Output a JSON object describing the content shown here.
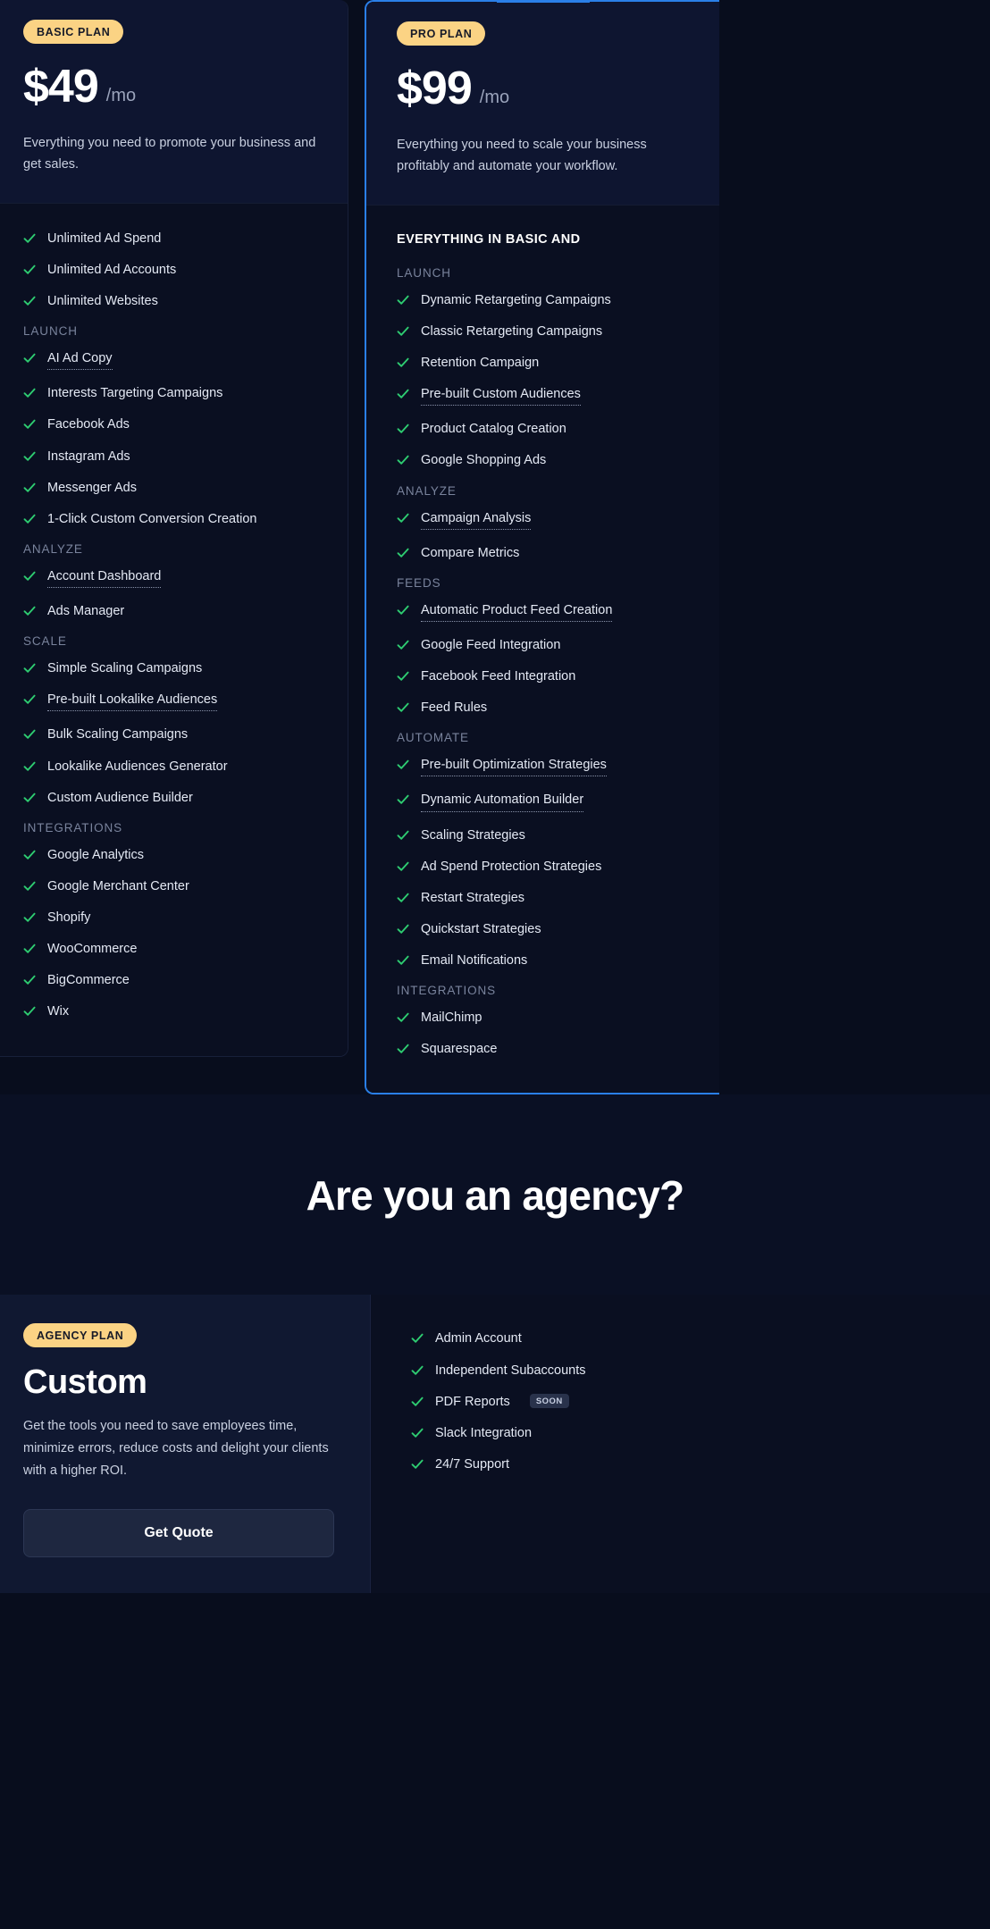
{
  "colors": {
    "page_bg": "#080d1d",
    "card_bg": "#0a0f21",
    "card_head_bg": "#0e1530",
    "accent_badge": "#fbd384",
    "accent_border": "#2a7fe8",
    "check_green": "#2ecc71",
    "muted_text": "#79839c",
    "body_text": "#c9d0e0"
  },
  "icons": {
    "check": "check-icon"
  },
  "plans": [
    {
      "id": "basic",
      "badge": "BASIC PLAN",
      "price": "$49",
      "period": "/mo",
      "blurb": "Everything you need to promote your business and get sales.",
      "everything_head": "",
      "sections": [
        {
          "label": "",
          "items": [
            {
              "label": "Unlimited Ad Spend",
              "tooltip": false
            },
            {
              "label": "Unlimited Ad Accounts",
              "tooltip": false
            },
            {
              "label": "Unlimited Websites",
              "tooltip": false
            }
          ]
        },
        {
          "label": "LAUNCH",
          "items": [
            {
              "label": "AI Ad Copy",
              "tooltip": true
            },
            {
              "label": "Interests Targeting Campaigns",
              "tooltip": false
            },
            {
              "label": "Facebook Ads",
              "tooltip": false
            },
            {
              "label": "Instagram Ads",
              "tooltip": false
            },
            {
              "label": "Messenger Ads",
              "tooltip": false
            },
            {
              "label": "1-Click Custom Conversion Creation",
              "tooltip": false
            }
          ]
        },
        {
          "label": "ANALYZE",
          "items": [
            {
              "label": "Account Dashboard",
              "tooltip": true
            },
            {
              "label": "Ads Manager",
              "tooltip": false
            }
          ]
        },
        {
          "label": "SCALE",
          "items": [
            {
              "label": "Simple Scaling Campaigns",
              "tooltip": false
            },
            {
              "label": "Pre-built Lookalike Audiences",
              "tooltip": true
            },
            {
              "label": "Bulk Scaling Campaigns",
              "tooltip": false
            },
            {
              "label": "Lookalike Audiences Generator",
              "tooltip": false
            },
            {
              "label": "Custom Audience Builder",
              "tooltip": false
            }
          ]
        },
        {
          "label": "INTEGRATIONS",
          "items": [
            {
              "label": "Google Analytics",
              "tooltip": false
            },
            {
              "label": "Google Merchant Center",
              "tooltip": false
            },
            {
              "label": "Shopify",
              "tooltip": false
            },
            {
              "label": "WooCommerce",
              "tooltip": false
            },
            {
              "label": "BigCommerce",
              "tooltip": false
            },
            {
              "label": "Wix",
              "tooltip": false
            }
          ]
        }
      ]
    },
    {
      "id": "pro",
      "badge": "PRO PLAN",
      "price": "$99",
      "period": "/mo",
      "blurb": "Everything you need to scale your business profitably and automate your workflow.",
      "everything_head": "EVERYTHING IN BASIC AND",
      "sections": [
        {
          "label": "LAUNCH",
          "items": [
            {
              "label": "Dynamic Retargeting Campaigns",
              "tooltip": false
            },
            {
              "label": "Classic Retargeting Campaigns",
              "tooltip": false
            },
            {
              "label": "Retention Campaign",
              "tooltip": false
            },
            {
              "label": "Pre-built Custom Audiences",
              "tooltip": true
            },
            {
              "label": "Product Catalog Creation",
              "tooltip": false
            },
            {
              "label": "Google Shopping Ads",
              "tooltip": false
            }
          ]
        },
        {
          "label": "ANALYZE",
          "items": [
            {
              "label": "Campaign Analysis",
              "tooltip": true
            },
            {
              "label": "Compare Metrics",
              "tooltip": false
            }
          ]
        },
        {
          "label": "FEEDS",
          "items": [
            {
              "label": "Automatic Product Feed Creation",
              "tooltip": true
            },
            {
              "label": "Google Feed Integration",
              "tooltip": false
            },
            {
              "label": "Facebook Feed Integration",
              "tooltip": false
            },
            {
              "label": "Feed Rules",
              "tooltip": false
            }
          ]
        },
        {
          "label": "AUTOMATE",
          "items": [
            {
              "label": "Pre-built Optimization Strategies",
              "tooltip": true
            },
            {
              "label": "Dynamic Automation Builder",
              "tooltip": true
            },
            {
              "label": "Scaling Strategies",
              "tooltip": false
            },
            {
              "label": "Ad Spend Protection Strategies",
              "tooltip": false
            },
            {
              "label": "Restart Strategies",
              "tooltip": false
            },
            {
              "label": "Quickstart Strategies",
              "tooltip": false
            },
            {
              "label": "Email Notifications",
              "tooltip": false
            }
          ]
        },
        {
          "label": "INTEGRATIONS",
          "items": [
            {
              "label": "MailChimp",
              "tooltip": false
            },
            {
              "label": "Squarespace",
              "tooltip": false
            }
          ]
        }
      ]
    }
  ],
  "agency_banner": {
    "title": "Are you an agency?"
  },
  "agency_plan": {
    "badge": "AGENCY PLAN",
    "title": "Custom",
    "blurb": "Get the tools you need to save employees time, minimize errors, reduce costs and delight your clients with a higher ROI.",
    "cta_label": "Get Quote",
    "features": [
      {
        "label": "Admin Account",
        "badge": ""
      },
      {
        "label": "Independent Subaccounts",
        "badge": ""
      },
      {
        "label": "PDF Reports",
        "badge": "SOON"
      },
      {
        "label": "Slack Integration",
        "badge": ""
      },
      {
        "label": "24/7 Support",
        "badge": ""
      }
    ]
  }
}
